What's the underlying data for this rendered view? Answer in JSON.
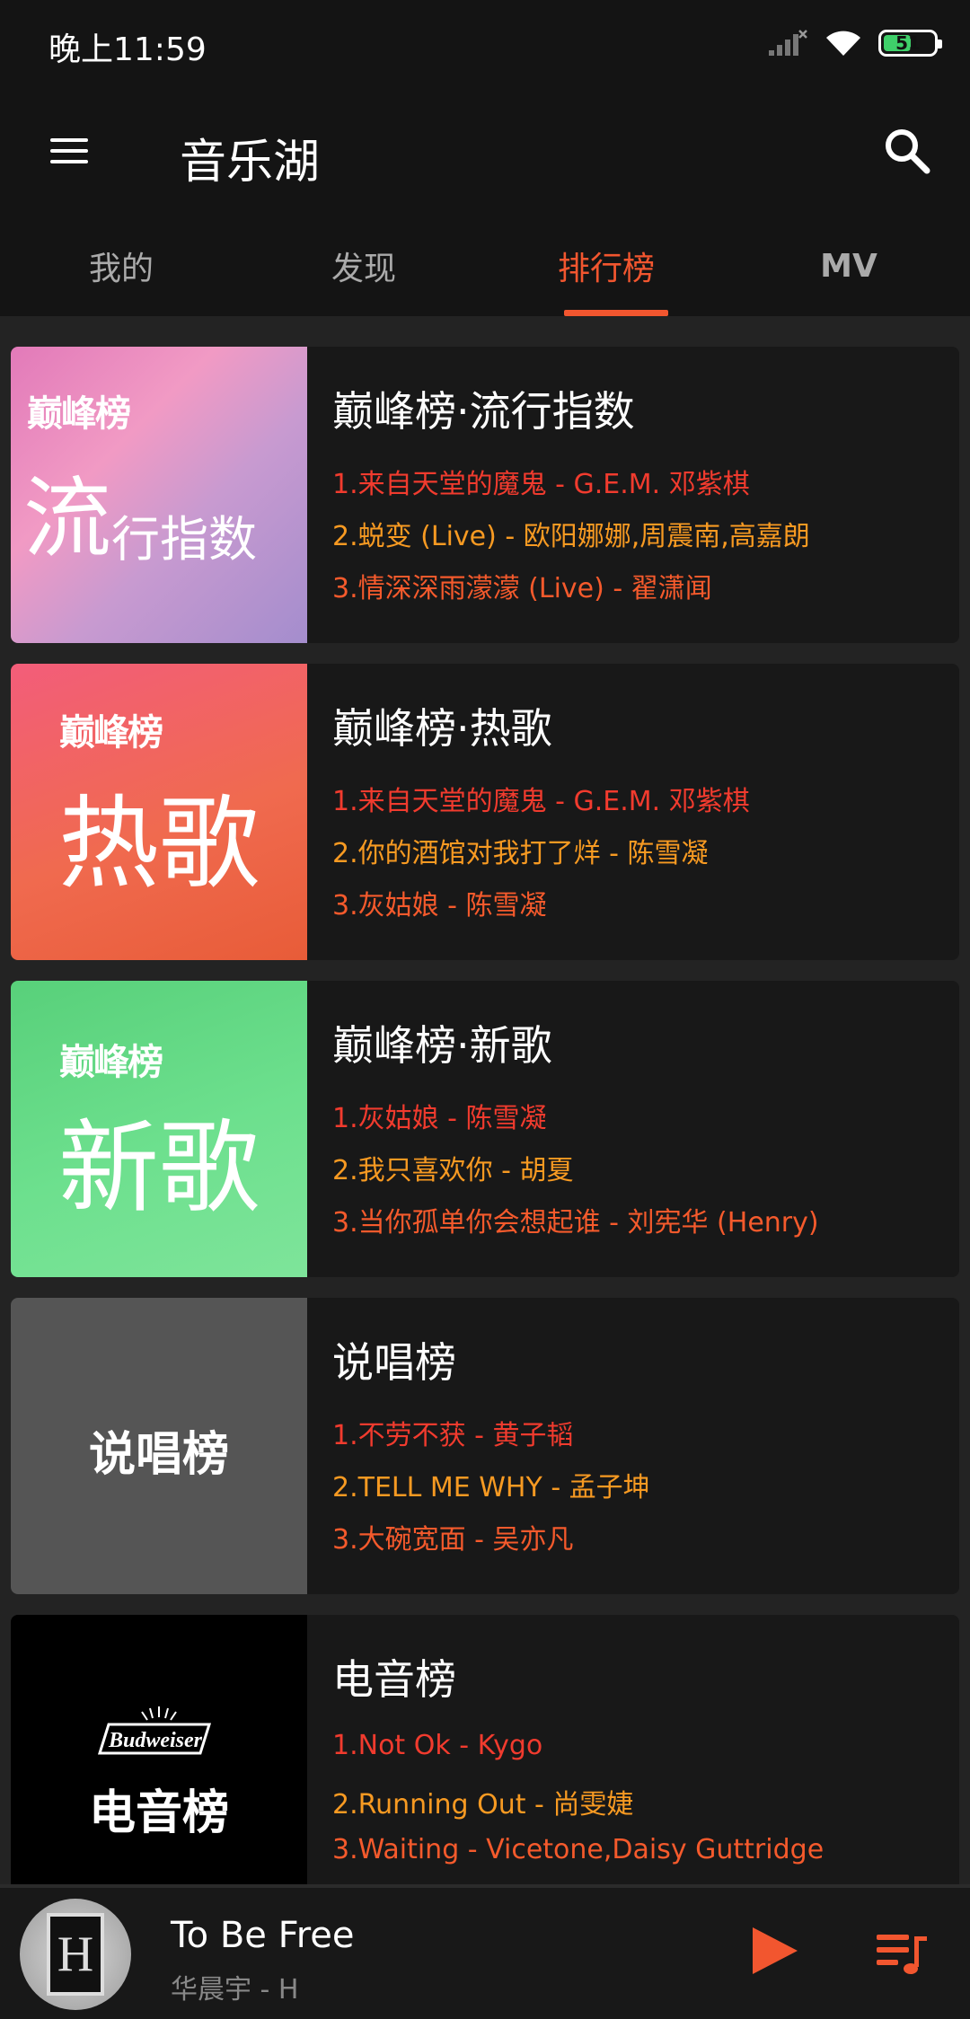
{
  "status": {
    "time": "晚上11:59",
    "battery": "51"
  },
  "app": {
    "title": "音乐湖"
  },
  "tabs": [
    {
      "label": "我的"
    },
    {
      "label": "发现"
    },
    {
      "label": "排行榜"
    },
    {
      "label": "MV"
    }
  ],
  "charts": [
    {
      "title": "巅峰榜·流行指数",
      "cover_brand": "巅峰榜",
      "cover_text_big": "流",
      "cover_text_small": "行指数",
      "songs": [
        "1.来自天堂的魔鬼 - G.E.M. 邓紫棋",
        "2.蜕变 (Live) - 欧阳娜娜,周震南,高嘉朗",
        "3.情深深雨濛濛 (Live) - 翟潇闻"
      ]
    },
    {
      "title": "巅峰榜·热歌",
      "cover_brand": "巅峰榜",
      "cover_text": "热歌",
      "songs": [
        "1.来自天堂的魔鬼 - G.E.M. 邓紫棋",
        "2.你的酒馆对我打了烊 - 陈雪凝",
        "3.灰姑娘 - 陈雪凝"
      ]
    },
    {
      "title": "巅峰榜·新歌",
      "cover_brand": "巅峰榜",
      "cover_text": "新歌",
      "songs": [
        "1.灰姑娘 - 陈雪凝",
        "2.我只喜欢你 - 胡夏",
        "3.当你孤单你会想起谁 - 刘宪华 (Henry)"
      ]
    },
    {
      "title": "说唱榜",
      "cover_text": "说唱榜",
      "songs": [
        "1.不劳不获 - 黄子韬",
        "2.TELL ME WHY - 孟子坤",
        "3.大碗宽面 - 吴亦凡"
      ]
    },
    {
      "title": "电音榜",
      "cover_brand": "Budweiser",
      "cover_text": "电音榜",
      "songs": [
        "1.Not Ok - Kygo",
        "2.Running Out - 尚雯婕",
        "3.Waiting - Vicetone,Daisy Guttridge"
      ]
    }
  ],
  "player": {
    "title": "To Be Free",
    "subtitle": "华晨宇 - H",
    "album_letter": "H"
  },
  "colors": {
    "accent": "#f2562f",
    "rank1": "#f13b2e",
    "rank2": "#f79a22",
    "rank3": "#f55a2c"
  }
}
